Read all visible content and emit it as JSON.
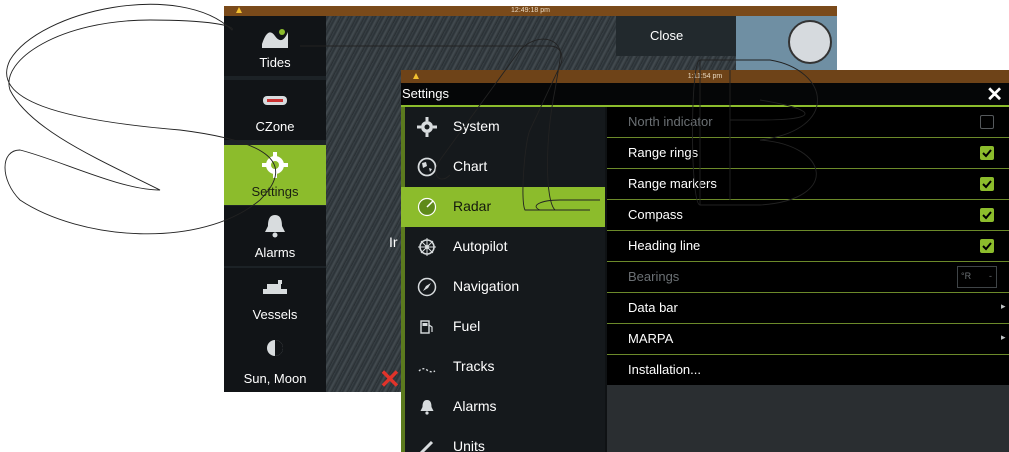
{
  "back_window": {
    "status_time": "12:49:18 pm",
    "close_label": "Close",
    "partial_text": "Ir",
    "drawer_items": [
      {
        "label": "Tides",
        "icon": "tides-icon"
      },
      {
        "label": "CZone",
        "icon": "czone-icon"
      },
      {
        "label": "Settings",
        "icon": "gear-icon",
        "selected": true
      },
      {
        "label": "Alarms",
        "icon": "bell-icon"
      },
      {
        "label": "Vessels",
        "icon": "ship-icon"
      },
      {
        "label": "Sun, Moon",
        "icon": "sun-moon-icon"
      }
    ]
  },
  "settings_window": {
    "status_time": "1:11:54 pm",
    "title": "Settings",
    "close_icon": "close-icon",
    "menu": [
      {
        "label": "System",
        "icon": "gear-icon"
      },
      {
        "label": "Chart",
        "icon": "globe-icon"
      },
      {
        "label": "Radar",
        "icon": "radar-icon",
        "selected": true
      },
      {
        "label": "Autopilot",
        "icon": "helm-icon"
      },
      {
        "label": "Navigation",
        "icon": "compass-icon"
      },
      {
        "label": "Fuel",
        "icon": "fuel-icon"
      },
      {
        "label": "Tracks",
        "icon": "tracks-icon"
      },
      {
        "label": "Alarms",
        "icon": "bell-icon"
      },
      {
        "label": "Units",
        "icon": "ruler-icon"
      }
    ],
    "options": [
      {
        "label": "North indicator",
        "control": "checkbox",
        "checked": false,
        "disabled": true
      },
      {
        "label": "Range rings",
        "control": "checkbox",
        "checked": true
      },
      {
        "label": "Range markers",
        "control": "checkbox",
        "checked": true
      },
      {
        "label": "Compass",
        "control": "checkbox",
        "checked": true
      },
      {
        "label": "Heading line",
        "control": "checkbox",
        "checked": true
      },
      {
        "label": "Bearings",
        "control": "select",
        "value": "°R",
        "disabled": true
      },
      {
        "label": "Data bar",
        "control": "submenu"
      },
      {
        "label": "MARPA",
        "control": "submenu"
      },
      {
        "label": "Installation...",
        "control": "none"
      }
    ]
  },
  "colors": {
    "accent": "#8cbc2c",
    "status_bar": "#6e4318",
    "panel_bg": "#000000"
  }
}
